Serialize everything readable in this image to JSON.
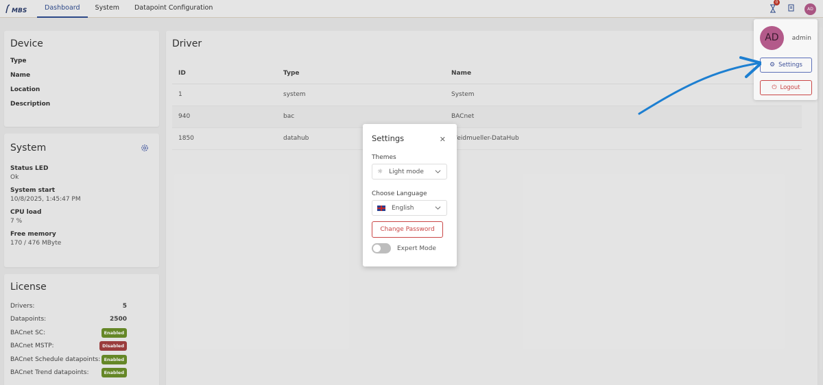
{
  "app": {
    "logo_text": "MBS"
  },
  "nav": {
    "tabs": [
      {
        "label": "Dashboard"
      },
      {
        "label": "System"
      },
      {
        "label": "Datapoint Configuration"
      }
    ]
  },
  "topbar": {
    "notification_count": "0",
    "avatar_initials": "AD"
  },
  "device": {
    "title": "Device",
    "fields": [
      "Type",
      "Name",
      "Location",
      "Description"
    ]
  },
  "system": {
    "title": "System",
    "items": [
      {
        "label": "Status LED",
        "value": "Ok"
      },
      {
        "label": "System start",
        "value": "10/8/2025, 1:45:47 PM"
      },
      {
        "label": "CPU load",
        "value": "7 %"
      },
      {
        "label": "Free memory",
        "value": "170 / 476 MByte"
      }
    ]
  },
  "license": {
    "title": "License",
    "rows": [
      {
        "label": "Drivers:",
        "value": "5"
      },
      {
        "label": "Datapoints:",
        "value": "2500"
      },
      {
        "label": "BACnet SC:",
        "badge": "Enabled"
      },
      {
        "label": "BACnet MSTP:",
        "badge": "Disabled"
      },
      {
        "label": "BACnet Schedule datapoints:",
        "badge": "Enabled"
      },
      {
        "label": "BACnet Trend datapoints:",
        "badge": "Enabled"
      }
    ]
  },
  "driver": {
    "title": "Driver",
    "columns": [
      "ID",
      "Type",
      "Name"
    ],
    "rows": [
      [
        "1",
        "system",
        "System"
      ],
      [
        "940",
        "bac",
        "BACnet"
      ],
      [
        "1850",
        "datahub",
        "Weidmueller-DataHub"
      ]
    ]
  },
  "settings_modal": {
    "title": "Settings",
    "themes_label": "Themes",
    "theme_value": "Light mode",
    "language_label": "Choose Language",
    "language_value": "English",
    "change_password": "Change Password",
    "expert_mode": "Expert Mode"
  },
  "user_menu": {
    "initials": "AD",
    "username": "admin",
    "settings": "Settings",
    "logout": "Logout"
  },
  "colors": {
    "accent": "#2e4b8f",
    "danger": "#c94545",
    "enabled": "#6b8f2a",
    "disabled": "#a34040",
    "avatar": "#b35a8a",
    "arrow": "#1d7fd1"
  }
}
